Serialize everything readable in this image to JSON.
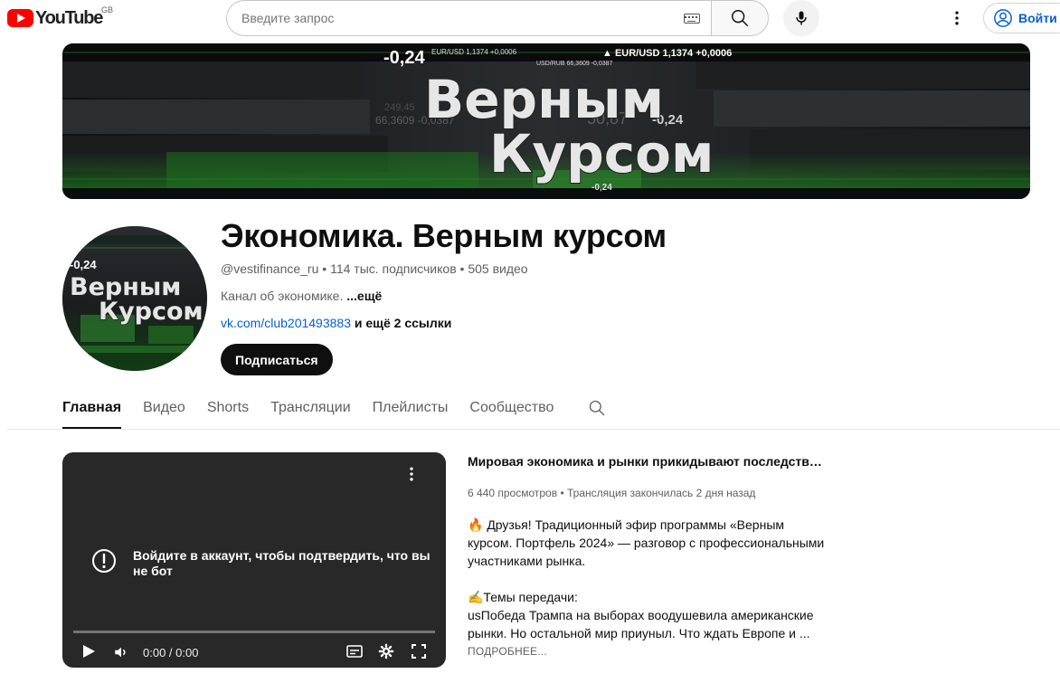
{
  "masthead": {
    "logo_text": "YouTube",
    "region": "GB",
    "search_placeholder": "Введите запрос",
    "signin_label": "Войти"
  },
  "banner": {
    "title_line1": "Верным",
    "title_line2": "Курсом",
    "ticker_1": "-0,24",
    "ticker_2": "EUR/USD 1,1374 +0,0006",
    "ticker_3": "USD/RUB 66,3609 -0,0387",
    "ticker_4": "-0,24",
    "ticker_5": "▲ EUR/USD 1,1374 +0,0006",
    "ticker_6": "50,87",
    "ticker_7": "66,3609 -0,0387",
    "ticker_8": "249,45",
    "ticker_9": "-0,24"
  },
  "avatar": {
    "title_line1": "Верным",
    "title_line2": "Курсом",
    "ticker": "-0,24"
  },
  "channel": {
    "title": "Экономика. Верным курсом",
    "handle": "@vestifinance_ru",
    "subscribers": "114 тыс. подписчиков",
    "videos": "505 видео",
    "description": "Канал об экономике.",
    "description_more": "...ещё",
    "link": "vk.com/club201493883",
    "links_extra": "и ещё 2 ссылки",
    "subscribe_label": "Подписаться"
  },
  "tabs": [
    {
      "label": "Главная",
      "active": true
    },
    {
      "label": "Видео",
      "active": false
    },
    {
      "label": "Shorts",
      "active": false
    },
    {
      "label": "Трансляции",
      "active": false
    },
    {
      "label": "Плейлисты",
      "active": false
    },
    {
      "label": "Сообщество",
      "active": false
    }
  ],
  "player": {
    "message": "Войдите в аккаунт, чтобы подтвердить, что вы не бот",
    "time": "0:00 / 0:00"
  },
  "video": {
    "title": "Мировая экономика и рынки прикидывают последствия выборов в США",
    "views": "6 440 просмотров",
    "status": "Трансляция закончилась 2 дня назад",
    "desc_line1": "🔥 Друзья! Традиционный эфир программы «Верным курсом. Портфель 2024» — разговор с профессиональными участниками рынка.",
    "desc_line2": "✍️Темы передачи:",
    "desc_line3": "usПобеда Трампа на выборах воодушевила американские рынки. Но остальной мир приуныл. Что ждать Европе и ...",
    "more_label": "ПОДРОБНЕЕ..."
  },
  "colors": {
    "accent_red": "#ff0000",
    "link_blue": "#065fd4",
    "banner_green": "#2e8b2e"
  }
}
